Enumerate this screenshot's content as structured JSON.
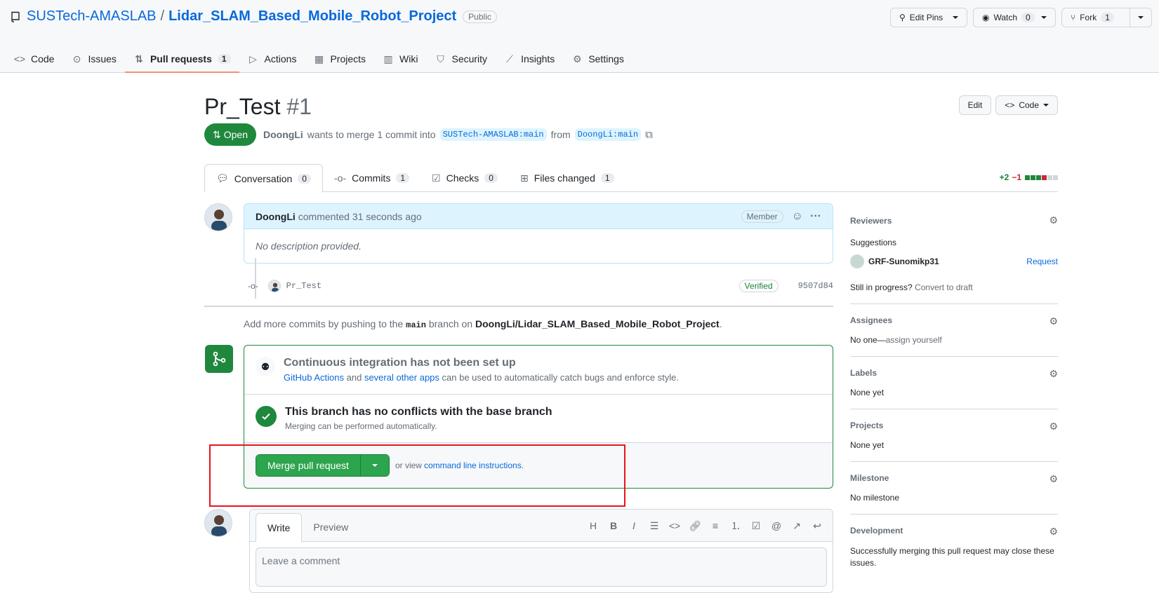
{
  "repo": {
    "owner": "SUSTech-AMASLAB",
    "separator": "/",
    "name": "Lidar_SLAM_Based_Mobile_Robot_Project",
    "visibility": "Public"
  },
  "repo_actions": {
    "edit_pins": "Edit Pins",
    "watch": "Watch",
    "watch_count": "0",
    "fork": "Fork",
    "fork_count": "1"
  },
  "nav": {
    "code": "Code",
    "issues": "Issues",
    "pull_requests": "Pull requests",
    "pull_requests_count": "1",
    "actions": "Actions",
    "projects": "Projects",
    "wiki": "Wiki",
    "security": "Security",
    "insights": "Insights",
    "settings": "Settings"
  },
  "pr": {
    "title": "Pr_Test",
    "number": "#1",
    "edit": "Edit",
    "code": "Code",
    "state": "Open",
    "author": "DoongLi",
    "merge_text": "wants to merge 1 commit into",
    "base_branch": "SUSTech-AMASLAB:main",
    "from_text": "from",
    "head_branch": "DoongLi:main"
  },
  "tabs": {
    "conversation": "Conversation",
    "conversation_count": "0",
    "commits": "Commits",
    "commits_count": "1",
    "checks": "Checks",
    "checks_count": "0",
    "files": "Files changed",
    "files_count": "1"
  },
  "diffstat": {
    "additions": "+2",
    "deletions": "−1",
    "colors": [
      "#1f883d",
      "#1f883d",
      "#1f883d",
      "#d1242f",
      "#d0d7de",
      "#d0d7de"
    ]
  },
  "comment": {
    "author": "DoongLi",
    "action": "commented",
    "time": "31 seconds ago",
    "role": "Member",
    "body": "No description provided."
  },
  "commit": {
    "message": "Pr_Test",
    "badge": "Verified",
    "sha": "9507d84"
  },
  "add_more": {
    "prefix": "Add more commits by pushing to the",
    "branch": "main",
    "middle": "branch on",
    "repo": "DoongLi/Lidar_SLAM_Based_Mobile_Robot_Project",
    "suffix": "."
  },
  "merge": {
    "ci_title": "Continuous integration has not been set up",
    "ci_link1": "GitHub Actions",
    "ci_and": "and",
    "ci_link2": "several other apps",
    "ci_rest": "can be used to automatically catch bugs and enforce style.",
    "conflict_title": "This branch has no conflicts with the base branch",
    "conflict_sub": "Merging can be performed automatically.",
    "merge_button": "Merge pull request",
    "or_view": "or view",
    "cli_link": "command line instructions",
    "period": "."
  },
  "editor": {
    "write": "Write",
    "preview": "Preview",
    "placeholder": "Leave a comment"
  },
  "sidebar": {
    "reviewers": "Reviewers",
    "suggestions": "Suggestions",
    "reviewer_name": "GRF-Sunomikp31",
    "request": "Request",
    "in_progress": "Still in progress?",
    "convert_draft": "Convert to draft",
    "assignees": "Assignees",
    "assignees_value": "No one—",
    "assign_yourself": "assign yourself",
    "labels": "Labels",
    "labels_value": "None yet",
    "projects": "Projects",
    "projects_value": "None yet",
    "milestone": "Milestone",
    "milestone_value": "No milestone",
    "development": "Development",
    "development_value": "Successfully merging this pull request may close these issues."
  }
}
